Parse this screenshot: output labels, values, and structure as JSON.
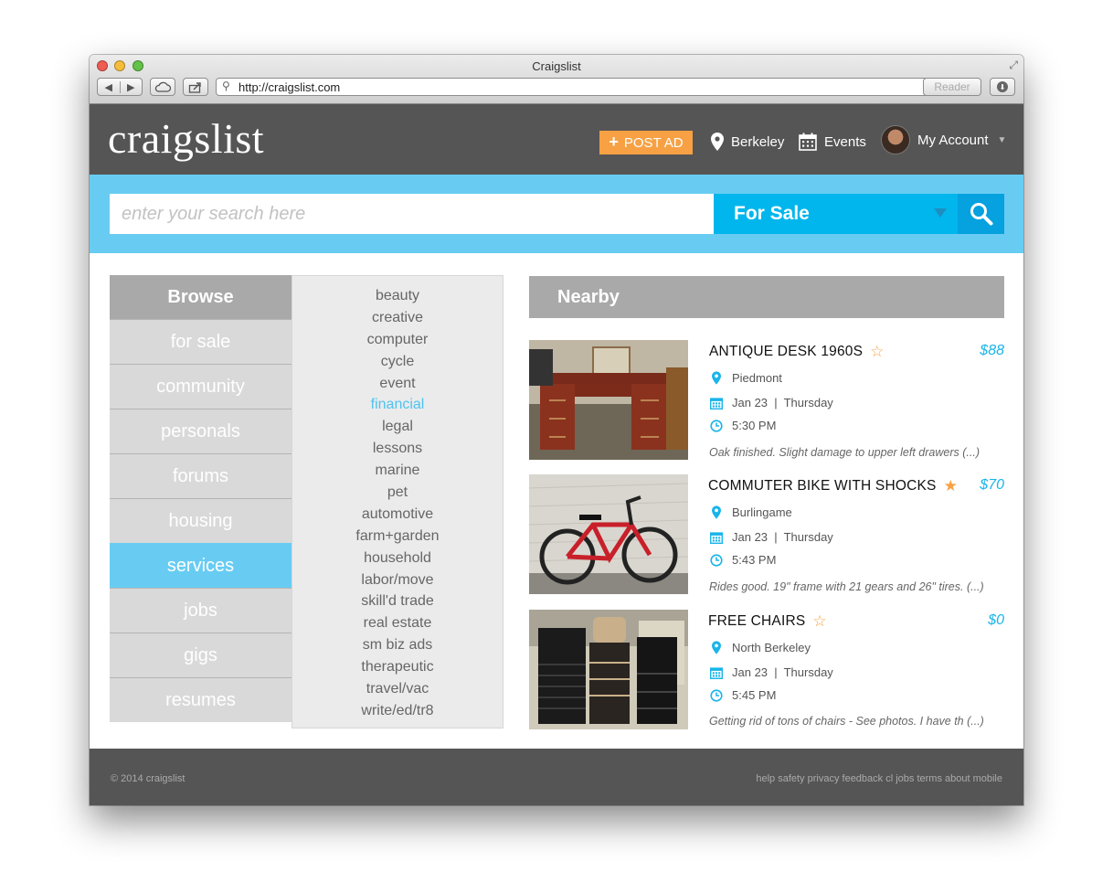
{
  "browser": {
    "window_title": "Craigslist",
    "url": "http://craigslist.com",
    "reader_label": "Reader"
  },
  "header": {
    "logo": "craigslist",
    "post_ad_label": "POST AD",
    "location_label": "Berkeley",
    "events_label": "Events",
    "account_label": "My Account"
  },
  "search": {
    "placeholder": "enter your search here",
    "category": "For Sale"
  },
  "browse": {
    "title": "Browse",
    "items": [
      "for sale",
      "community",
      "personals",
      "forums",
      "housing",
      "services",
      "jobs",
      "gigs",
      "resumes"
    ],
    "active": "services"
  },
  "subcategories": {
    "items": [
      "beauty",
      "creative",
      "computer",
      "cycle",
      "event",
      "financial",
      "legal",
      "lessons",
      "marine",
      "pet",
      "automotive",
      "farm+garden",
      "household",
      "labor/move",
      "skill'd trade",
      "real estate",
      "sm biz ads",
      "therapeutic",
      "travel/vac",
      "write/ed/tr8"
    ],
    "active": "financial"
  },
  "nearby": {
    "title": "Nearby",
    "listings": [
      {
        "title": "ANTIQUE DESK 1960S",
        "starred": false,
        "price": "$88",
        "location": "Piedmont",
        "date": "Jan 23  |  Thursday",
        "time": "5:30 PM",
        "description": "Oak finished. Slight damage to upper left drawers (...)"
      },
      {
        "title": "COMMUTER BIKE WITH SHOCKS",
        "starred": true,
        "price": "$70",
        "location": "Burlingame",
        "date": "Jan 23  |  Thursday",
        "time": "5:43 PM",
        "description": "Rides good. 19\" frame with 21 gears and 26\" tires. (...)"
      },
      {
        "title": "FREE CHAIRS",
        "starred": false,
        "price": "$0",
        "location": "North Berkeley",
        "date": "Jan 23  |  Thursday",
        "time": "5:45 PM",
        "description": "Getting rid of tons of chairs - See photos. I have th (...)"
      }
    ]
  },
  "footer": {
    "copyright": "© 2014 craigslist",
    "links": "help safety privacy feedback cl jobs terms about mobile"
  },
  "colors": {
    "header_bg": "#555555",
    "accent_blue": "#68ccf2",
    "select_blue": "#00b6ec",
    "post_ad_orange": "#f7a144",
    "price_blue": "#19b4ea"
  }
}
